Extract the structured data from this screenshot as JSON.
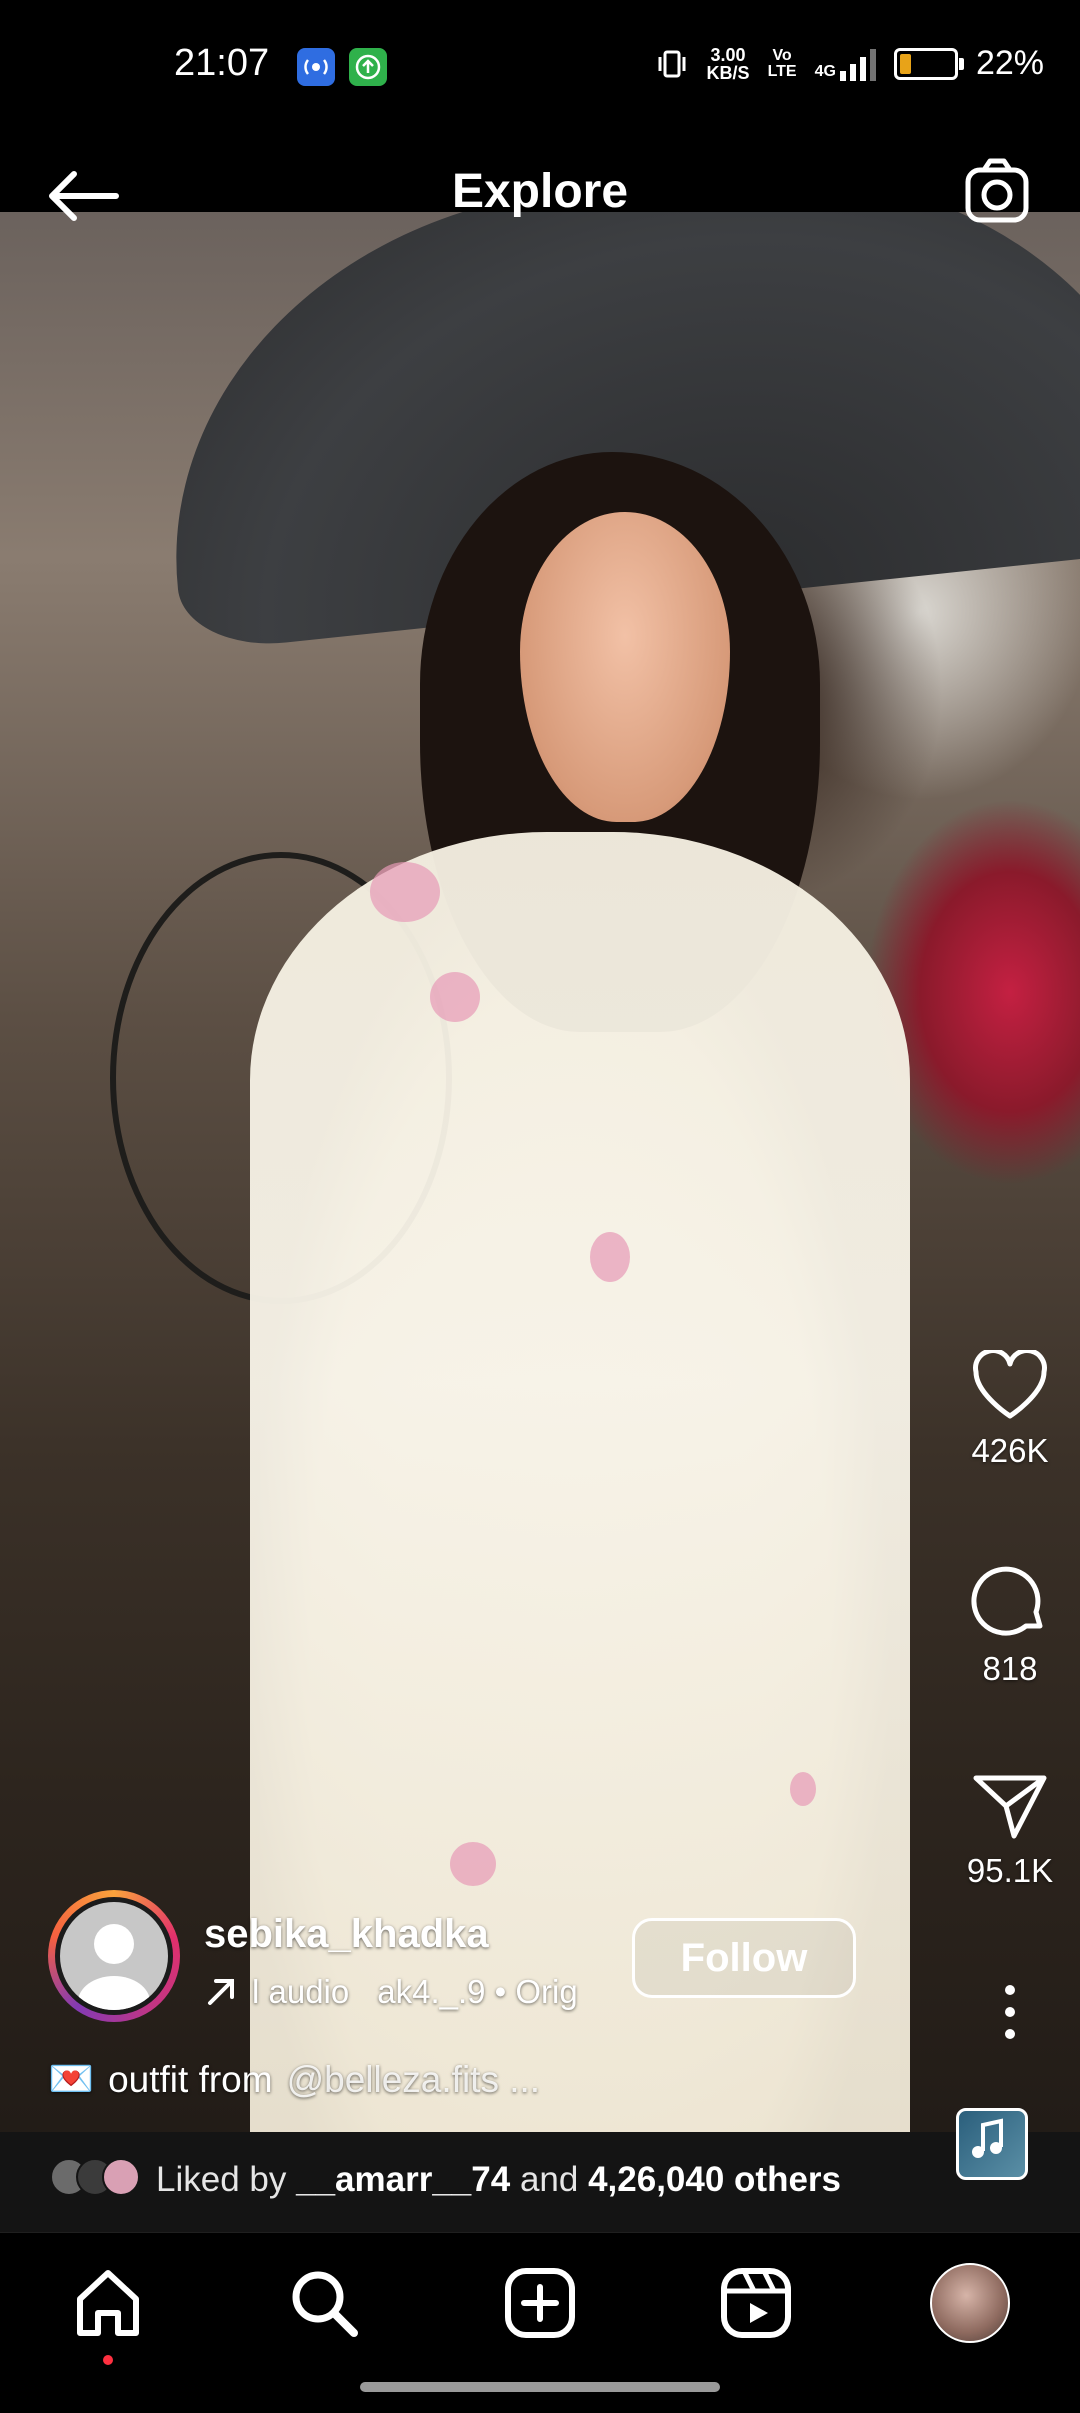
{
  "status_bar": {
    "time": "21:07",
    "net_speed_value": "3.00",
    "net_speed_unit": "KB/S",
    "volte_top": "Vo",
    "volte_bottom": "LTE",
    "network": "4G",
    "battery_level": 0.22,
    "battery_percent": "22%",
    "icons": [
      "radio-app-icon",
      "upload-app-icon",
      "vibrate-icon",
      "signal-icon",
      "battery-icon"
    ]
  },
  "header": {
    "title": "Explore",
    "back_icon": "arrow-left-icon",
    "camera_icon": "camera-icon"
  },
  "post": {
    "actions": {
      "likes": "426K",
      "comments": "818",
      "shares": "95.1K"
    },
    "author": {
      "username": "sebika_khadka",
      "follow_label": "Follow"
    },
    "audio": {
      "label": "l audio",
      "source": "ak4._.9 • Orig"
    },
    "caption": {
      "emoji": "💌",
      "text": "outfit from",
      "mention": "@belleza.fits ..."
    },
    "liked_by": {
      "prefix": "Liked by",
      "user": "__amarr__74",
      "middle": "and",
      "others": "4,26,040 others"
    }
  },
  "nav": {
    "items": [
      "home-icon",
      "search-icon",
      "create-icon",
      "reels-icon",
      "profile-avatar"
    ],
    "active": "home-icon"
  },
  "colors": {
    "like_dot": "#ff3040",
    "battery_fill": "#e8a318",
    "ring_start": "#f9a23c",
    "ring_end": "#c13584"
  }
}
